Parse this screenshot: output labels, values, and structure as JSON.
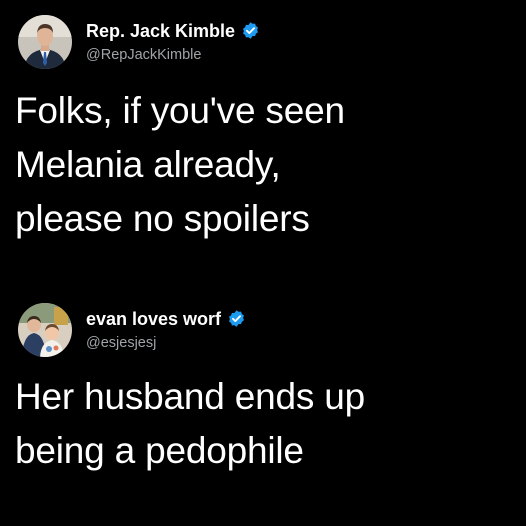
{
  "posts": [
    {
      "display_name": "Rep. Jack Kimble",
      "handle": "@RepJackKimble",
      "verified": true,
      "avatar_icon": "person-in-suit-avatar",
      "text": "Folks, if you've seen\nMelania already,\nplease no spoilers"
    },
    {
      "display_name": "evan loves worf",
      "handle": "@esjesjesj",
      "verified": true,
      "avatar_icon": "people-photo-avatar",
      "text": "Her husband ends up\nbeing a pedophile"
    }
  ],
  "colors": {
    "background": "#000000",
    "text": "#ffffff",
    "handle": "#a0a4a8",
    "verified_badge": "#1d9bf0"
  }
}
